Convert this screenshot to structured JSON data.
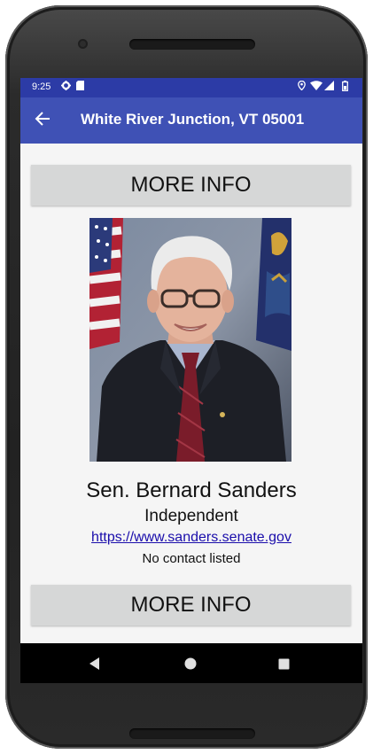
{
  "status_bar": {
    "time": "9:25",
    "left_icons": [
      "gear-icon",
      "sd-card-icon"
    ],
    "right_icons": [
      "location-icon",
      "wifi-icon",
      "signal-icon",
      "battery-icon"
    ]
  },
  "app_bar": {
    "title": "White River Junction, VT 05001",
    "back_icon": "arrow-back-icon"
  },
  "buttons": {
    "more_info_top": "MORE INFO",
    "more_info_bottom": "MORE INFO"
  },
  "official": {
    "name": "Sen. Bernard Sanders",
    "party": "Independent",
    "url": "https://www.sanders.senate.gov",
    "contact": "No contact listed"
  },
  "nav_bar": {
    "back": "back-triangle-icon",
    "home": "home-circle-icon",
    "recents": "recents-square-icon"
  },
  "colors": {
    "status_bar": "#2c3ba6",
    "app_bar": "#3f51b5",
    "button_bg": "#d6d7d7",
    "link": "#1a0dab",
    "screen_bg": "#f5f5f5"
  }
}
